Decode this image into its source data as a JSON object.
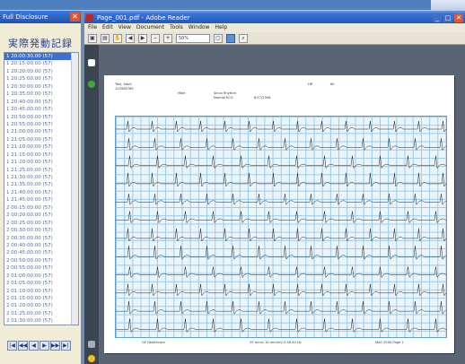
{
  "left_window": {
    "title": "Full Disclosure",
    "heading": "実際発動記録",
    "list_items": [
      "1 20:00:30.00 (57)",
      "1 20:15:00.00 (57)",
      "1 20:20:00.00 (57)",
      "1 20:25:00.00 (57)",
      "1 20:30:00.00 (57)",
      "1 20:35:00.00 (57)",
      "1 20:40:00.00 (57)",
      "1 20:45:00.00 (57)",
      "1 20:50:00.00 (57)",
      "1 20:55:00.00 (57)",
      "1 21:00:00.00 (57)",
      "1 21:05:00.00 (57)",
      "1 21:10:00.00 (57)",
      "1 21:15:00.00 (57)",
      "1 21:20:00.00 (57)",
      "1 21:25:00.00 (57)",
      "1 21:30:00.00 (57)",
      "1 21:35:00.00 (57)",
      "1 21:40:00.00 (57)",
      "1 21:45:00.00 (57)",
      "2 00:15:00.00 (57)",
      "2 00:20:00.00 (57)",
      "2 00:25:00.00 (57)",
      "2 00:30:00.00 (57)",
      "2 00:35:00.00 (57)",
      "2 00:40:00.00 (57)",
      "2 00:45:00.00 (57)",
      "2 00:50:00.00 (57)",
      "2 00:55:00.00 (57)",
      "2 01:00:00.00 (57)",
      "2 01:05:00.00 (57)",
      "2 01:10:00.00 (57)",
      "2 01:15:00.00 (57)",
      "2 01:20:00.00 (57)",
      "2 01:25:00.00 (57)",
      "2 01:30:00.00 (57)",
      "2 01:35:00.00 (57)",
      "2 01:40:00.00 (57)"
    ],
    "selected_index": 0,
    "nav_buttons": [
      "|◀",
      "◀◀",
      "◀",
      "▶",
      "▶▶",
      "▶|"
    ]
  },
  "reader": {
    "title": "Page_001.pdf - Adobe Reader",
    "menu": [
      "File",
      "Edit",
      "View",
      "Document",
      "Tools",
      "Window",
      "Help"
    ],
    "zoom": "50%",
    "page_header": {
      "name": "Test, Adult",
      "id": "123456789",
      "sex": "Male",
      "date": "8/17/2008",
      "hr": "HR",
      "rate": "60",
      "text_1": "Sinus Rhythm",
      "text_2": "Normal ECG"
    },
    "page_footer": {
      "left": "GE Healthcare",
      "mid": "25 mm/s   10 mm/mV   0.56-40 Hz",
      "right": "MAC 5500   Page 1"
    },
    "icons": {
      "left_strip": [
        "pages-icon",
        "bookmark-icon",
        "attachment-icon",
        "comment-icon"
      ]
    }
  }
}
